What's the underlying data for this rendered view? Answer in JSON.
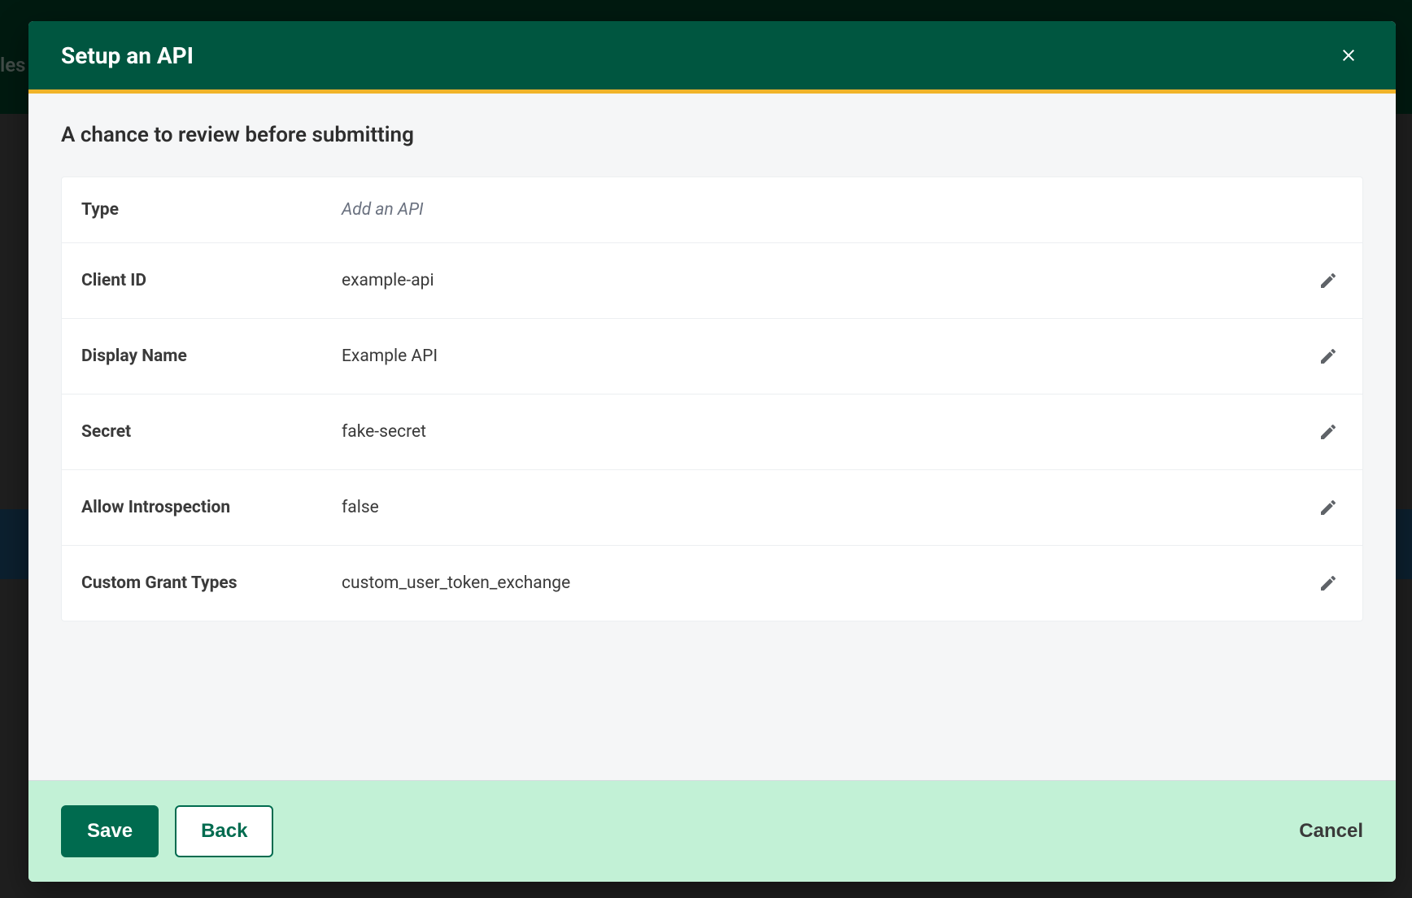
{
  "background": {
    "partial_text": "les"
  },
  "modal": {
    "title": "Setup an API",
    "subtitle": "A chance to review before submitting",
    "rows": [
      {
        "label": "Type",
        "value": "Add an API",
        "italic": true,
        "editable": false
      },
      {
        "label": "Client ID",
        "value": "example-api",
        "italic": false,
        "editable": true
      },
      {
        "label": "Display Name",
        "value": "Example API",
        "italic": false,
        "editable": true
      },
      {
        "label": "Secret",
        "value": "fake-secret",
        "italic": false,
        "editable": true
      },
      {
        "label": "Allow Introspection",
        "value": "false",
        "italic": false,
        "editable": true
      },
      {
        "label": "Custom Grant Types",
        "value": "custom_user_token_exchange",
        "italic": false,
        "editable": true
      }
    ],
    "footer": {
      "save_label": "Save",
      "back_label": "Back",
      "cancel_label": "Cancel"
    }
  }
}
